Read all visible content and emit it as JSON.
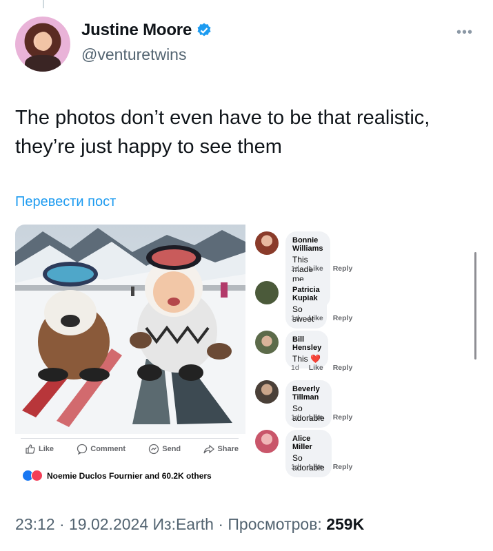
{
  "tweet": {
    "author_name": "Justine Moore",
    "author_handle": "@venturetwins",
    "more_icon": "ellipsis-icon",
    "text": "The photos don’t even have to be that realistic, they’re just happy to see them",
    "translate_label": "Перевести пост",
    "footer_time": "23:12 · 19.02.2024 Из:Earth · Просмотров: ",
    "footer_views": "259K"
  },
  "fb_post": {
    "actions": [
      {
        "label": "Like",
        "icon": "thumbs-up-icon"
      },
      {
        "label": "Comment",
        "icon": "comment-bubble-icon"
      },
      {
        "label": "Send",
        "icon": "messenger-icon"
      },
      {
        "label": "Share",
        "icon": "share-arrow-icon"
      }
    ],
    "reactions_text": "Noemie Duclos Fournier and 60.2K others"
  },
  "comments": [
    {
      "name": "Bonnie Williams",
      "text": "This made me smile.",
      "emoji": "😊",
      "time": "1d",
      "like": "Like",
      "reply": "Reply"
    },
    {
      "name": "Patricia Kupiak",
      "text": "So sweet",
      "emoji": "",
      "time": "1d",
      "like": "Like",
      "reply": "Reply"
    },
    {
      "name": "Bill Hensley",
      "text": "This",
      "emoji": "❤️",
      "time": "1d",
      "like": "Like",
      "reply": "Reply"
    },
    {
      "name": "Beverly Tillman",
      "text": "So adorable",
      "emoji": "",
      "time": "1d",
      "like": "Like",
      "reply": "Reply"
    },
    {
      "name": "Alice Miller",
      "text": "So adorable",
      "emoji": "",
      "time": "1d",
      "like": "Like",
      "reply": "Reply"
    }
  ],
  "colors": {
    "accent": "#1d9bf0",
    "verified": "#1d9bf0",
    "fb_blue": "#1877f2",
    "love": "#f33e58"
  }
}
